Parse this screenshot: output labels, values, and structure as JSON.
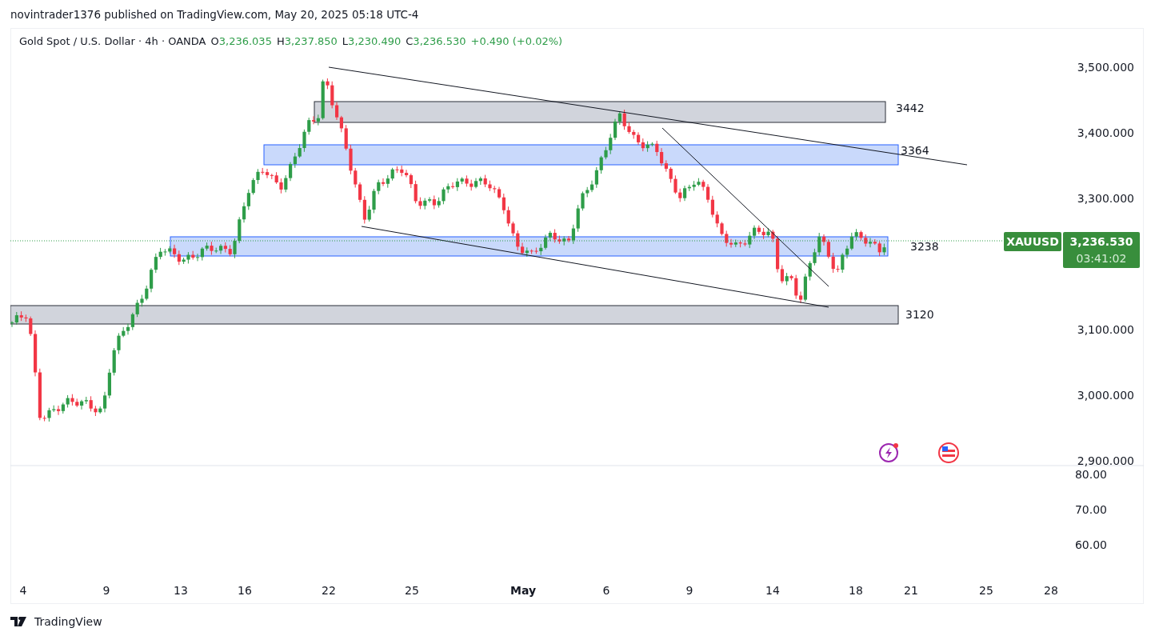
{
  "attribution": "novintrader1376 published on TradingView.com, May 20, 2025 05:18 UTC-4",
  "legend": {
    "symbol": "Gold Spot / U.S. Dollar · 4h · OANDA",
    "values": [
      {
        "label": "O",
        "value": "3,236.035"
      },
      {
        "label": "H",
        "value": "3,237.850"
      },
      {
        "label": "L",
        "value": "3,230.490"
      },
      {
        "label": "C",
        "value": "3,236.530"
      }
    ],
    "change": "+0.490 (+0.02%)"
  },
  "zones": [
    {
      "label": "3442",
      "color": "#d1d4dc"
    },
    {
      "label": "3364",
      "color": "#c9d9fb"
    },
    {
      "label": "3238",
      "color": "#c9d9fb"
    },
    {
      "label": "3120",
      "color": "#d1d4dc"
    }
  ],
  "price_axis": [
    "3,500.000",
    "3,400.000",
    "3,300.000",
    "3,100.000",
    "3,000.000",
    "2,900.000"
  ],
  "indicator_axis": [
    "80.00",
    "70.00",
    "60.00"
  ],
  "time_axis": [
    {
      "label": "4",
      "kind": "day"
    },
    {
      "label": "9",
      "kind": "day"
    },
    {
      "label": "13",
      "kind": "day"
    },
    {
      "label": "16",
      "kind": "day"
    },
    {
      "label": "22",
      "kind": "day"
    },
    {
      "label": "25",
      "kind": "day"
    },
    {
      "label": "May",
      "kind": "month"
    },
    {
      "label": "6",
      "kind": "day"
    },
    {
      "label": "9",
      "kind": "day"
    },
    {
      "label": "14",
      "kind": "day"
    },
    {
      "label": "18",
      "kind": "day"
    },
    {
      "label": "21",
      "kind": "day"
    },
    {
      "label": "25",
      "kind": "day"
    },
    {
      "label": "28",
      "kind": "day"
    }
  ],
  "price_tag": {
    "symbol": "XAUUSD",
    "price": "3,236.530",
    "countdown": "03:41:02"
  },
  "footer": {
    "brand": "TradingView"
  }
}
